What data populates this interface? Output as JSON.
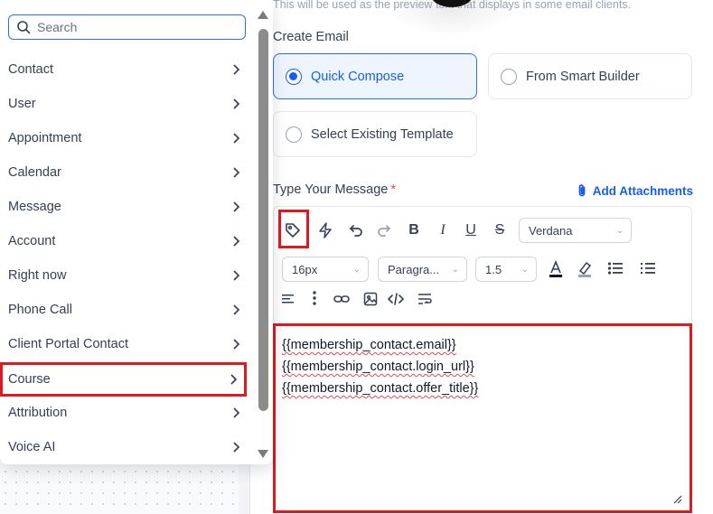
{
  "helper_text": "This will be used as the preview text that displays in some email clients.",
  "create_email": {
    "label": "Create Email",
    "options": [
      {
        "label": "Quick Compose",
        "selected": true
      },
      {
        "label": "From Smart Builder",
        "selected": false
      },
      {
        "label": "Select Existing Template",
        "selected": false
      }
    ]
  },
  "message": {
    "label": "Type Your Message",
    "required_mark": "*",
    "attach_label": "Add Attachments",
    "font_family": "Verdana",
    "font_size": "16px",
    "block_style": "Paragra...",
    "line_height": "1.5",
    "lines": [
      "{{membership_contact.email}}",
      "{{membership_contact.login_url}}",
      "{{membership_contact.offer_title}}"
    ]
  },
  "dropdown": {
    "search_placeholder": "Search",
    "items": [
      "Contact",
      "User",
      "Appointment",
      "Calendar",
      "Message",
      "Account",
      "Right now",
      "Phone Call",
      "Client Portal Contact",
      "Course",
      "Attribution",
      "Voice AI"
    ],
    "highlighted_item": "Course"
  },
  "colors": {
    "accent": "#155eef",
    "highlight_box": "#e0191f",
    "required": "#e5484d"
  }
}
